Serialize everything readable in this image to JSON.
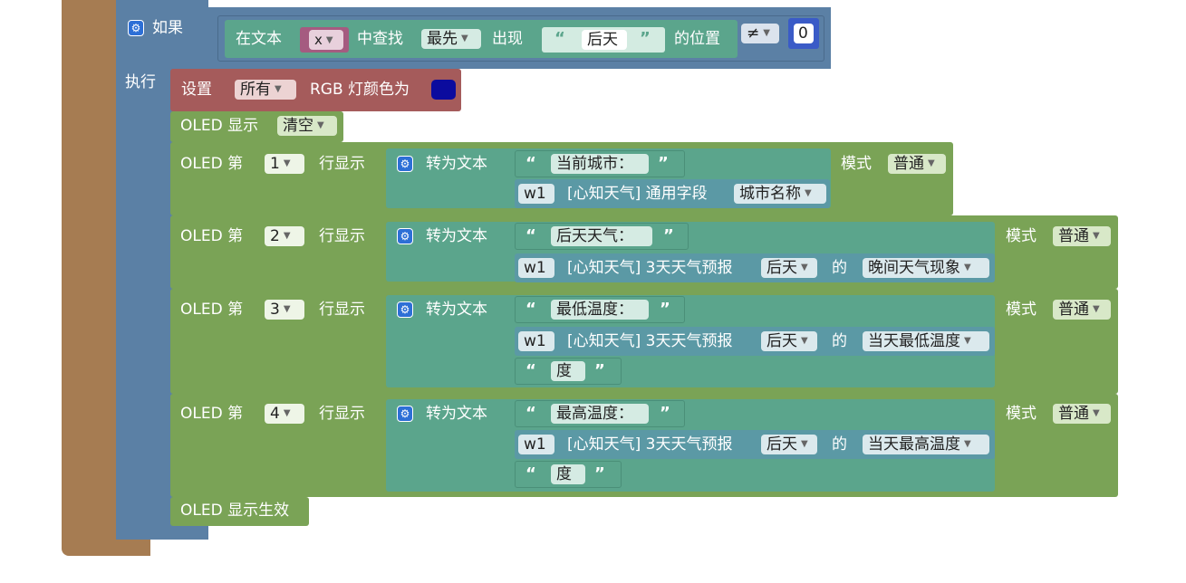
{
  "if_block": {
    "label_if": "如果",
    "label_do": "执行",
    "find_prefix": "在文本",
    "var": "x",
    "find_mid": "中查找",
    "find_mode": "最先",
    "find_appear": "出现",
    "find_text": "后天",
    "find_suffix": "的位置",
    "operator": "≠",
    "compare_value": "0"
  },
  "rgb_block": {
    "label_set": "设置",
    "target": "所有",
    "label_rgb": "RGB 灯颜色为",
    "color": "#0b0b9e"
  },
  "oled_clear": {
    "label": "OLED 显示",
    "mode": "清空"
  },
  "oled_rows": [
    {
      "prefix": "OLED 第",
      "line": "1",
      "suffix": "行显示",
      "to_text": "转为文本",
      "text1": "当前城市：",
      "w1_label": "w1",
      "w1_source": "[心知天气] 通用字段",
      "w1_field": "城市名称",
      "mode_label": "模式",
      "mode": "普通"
    },
    {
      "prefix": "OLED 第",
      "line": "2",
      "suffix": "行显示",
      "to_text": "转为文本",
      "text1": "后天天气：",
      "w1_label": "w1",
      "w1_source": "[心知天气] 3天天气预报",
      "w1_day": "后天",
      "w1_of": "的",
      "w1_field": "晚间天气现象",
      "mode_label": "模式",
      "mode": "普通"
    },
    {
      "prefix": "OLED 第",
      "line": "3",
      "suffix": "行显示",
      "to_text": "转为文本",
      "text1": "最低温度：",
      "w1_label": "w1",
      "w1_source": "[心知天气] 3天天气预报",
      "w1_day": "后天",
      "w1_of": "的",
      "w1_field": "当天最低温度",
      "text3": "度",
      "mode_label": "模式",
      "mode": "普通"
    },
    {
      "prefix": "OLED 第",
      "line": "4",
      "suffix": "行显示",
      "to_text": "转为文本",
      "text1": "最高温度：",
      "w1_label": "w1",
      "w1_source": "[心知天气] 3天天气预报",
      "w1_day": "后天",
      "w1_of": "的",
      "w1_field": "当天最高温度",
      "text3": "度",
      "mode_label": "模式",
      "mode": "普通"
    }
  ],
  "oled_apply": {
    "label": "OLED 显示生效"
  },
  "colors": {
    "control_outer": "#a67c52",
    "logic": "#5b80a5",
    "oled": "#7aa356",
    "text": "#5ba58c",
    "weather": "#5b99a5",
    "rgb": "#a55b5b"
  }
}
